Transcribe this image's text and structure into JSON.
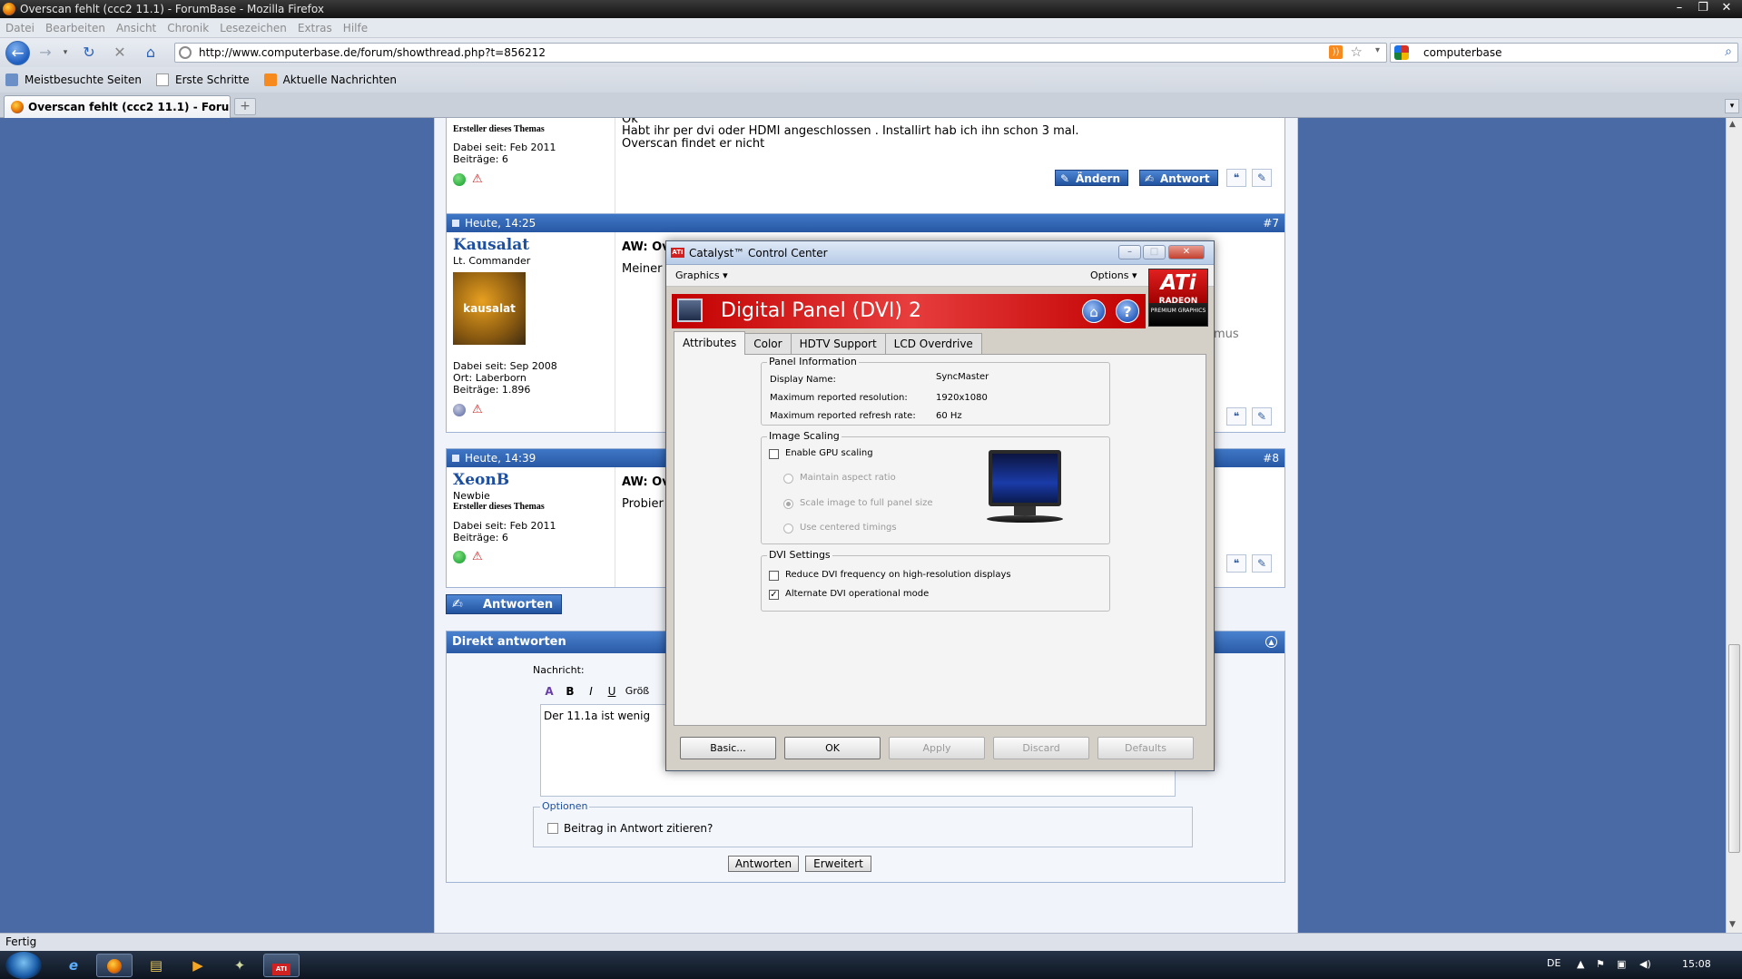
{
  "browser": {
    "window_title": "Overscan fehlt (ccc2 11.1) - ForumBase - Mozilla Firefox",
    "menu": [
      "Datei",
      "Bearbeiten",
      "Ansicht",
      "Chronik",
      "Lesezeichen",
      "Extras",
      "Hilfe"
    ],
    "url": "http://www.computerbase.de/forum/showthread.php?t=856212",
    "search_value": "computerbase",
    "bookmarks": [
      "Meistbesuchte Seiten",
      "Erste Schritte",
      "Aktuelle Nachrichten"
    ],
    "tab_title": "Overscan fehlt (ccc2 11.1) - ForumBase",
    "status": "Fertig"
  },
  "forum": {
    "post6": {
      "starter": "Ersteller dieses Themas",
      "since": "Dabei seit: Feb 2011",
      "posts": "Beiträge: 6",
      "text_top": "Ok",
      "text_line1": "Habt ihr per dvi oder HDMI angeschlossen . Installirt hab ich ihn schon 3 mal.",
      "text_line2": "Overscan findet er nicht",
      "edit_label": "Ändern",
      "answer_label": "Antwort"
    },
    "post7": {
      "time": "Heute, 14:25",
      "number": "#7",
      "username": "Kausalat",
      "rank": "Lt. Commander",
      "avatar_text": "kausalat",
      "since": "Dabei seit: Sep 2008",
      "location": "Ort: Laberborn",
      "posts": "Beiträge: 1.896",
      "title": "AW: Ov",
      "text": "Meiner",
      "text_right": "mus"
    },
    "post8": {
      "time": "Heute, 14:39",
      "number": "#8",
      "username": "XeonB",
      "rank": "Newbie",
      "starter": "Ersteller dieses Themas",
      "since": "Dabei seit: Feb 2011",
      "posts": "Beiträge: 6",
      "title": "AW: Ov",
      "text": "Probier"
    },
    "reply_button": "Antworten",
    "direct_reply": {
      "title": "Direkt antworten",
      "message_label": "Nachricht:",
      "toolbar": [
        "B",
        "I",
        "U",
        "Größ"
      ],
      "message_value": "Der 11.1a ist wenig",
      "options_legend": "Optionen",
      "quote_label": "Beitrag in Antwort zitieren?",
      "submit": "Antworten",
      "advanced": "Erweitert"
    }
  },
  "ccc": {
    "title": "Catalyst™ Control Center",
    "app_icon_text": "ATI",
    "menu_graphics": "Graphics ▾",
    "menu_options": "Options ▾",
    "panel_title": "Digital Panel (DVI) 2",
    "logo_brand": "ATi",
    "logo_line2": "RADEON",
    "logo_line3": "PREMIUM GRAPHICS",
    "tabs": [
      "Attributes",
      "Color",
      "HDTV Support",
      "LCD Overdrive"
    ],
    "panel_info": {
      "legend": "Panel Information",
      "display_name_label": "Display Name:",
      "display_name": "SyncMaster",
      "max_res_label": "Maximum reported resolution:",
      "max_res": "1920x1080",
      "max_refresh_label": "Maximum reported refresh rate:",
      "max_refresh": "60 Hz"
    },
    "image_scaling": {
      "legend": "Image Scaling",
      "enable_gpu": "Enable GPU scaling",
      "maintain_aspect": "Maintain aspect ratio",
      "scale_full": "Scale image to full panel size",
      "centered": "Use centered timings"
    },
    "dvi": {
      "legend": "DVI Settings",
      "reduce_freq": "Reduce DVI frequency on high-resolution displays",
      "alternate_mode": "Alternate DVI operational mode"
    },
    "buttons": [
      "Basic...",
      "OK",
      "Apply",
      "Discard",
      "Defaults"
    ]
  },
  "taskbar": {
    "lang": "DE",
    "clock": "15:08"
  }
}
